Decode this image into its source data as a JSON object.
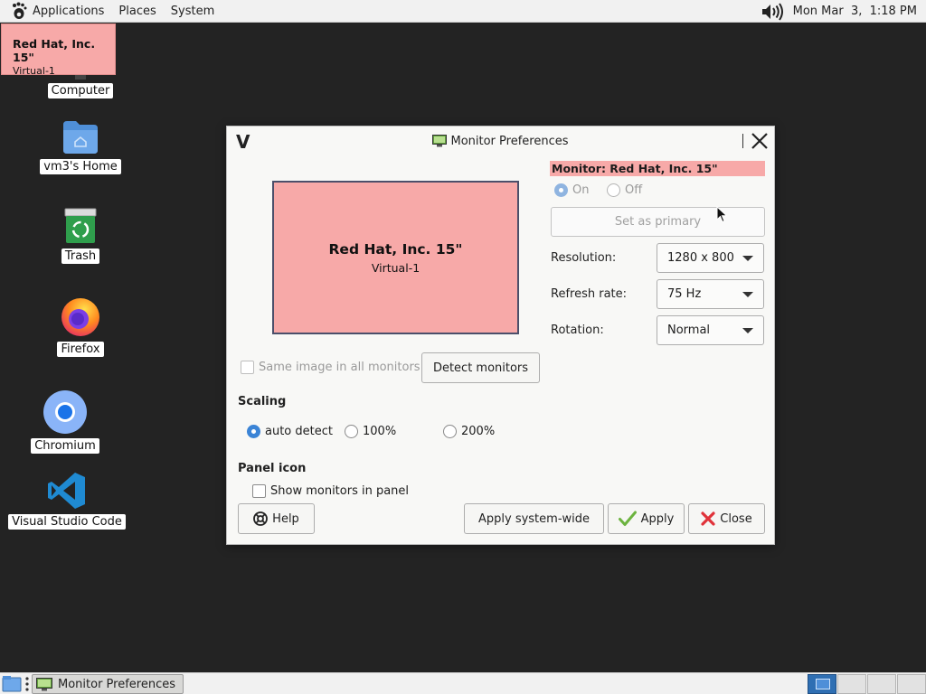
{
  "top_panel": {
    "menus": [
      "Applications",
      "Places",
      "System"
    ],
    "clock": "Mon Mar  3,  1:18 PM"
  },
  "desktop": {
    "icons": [
      {
        "label": "Computer",
        "icon": "computer-icon"
      },
      {
        "label": "vm3's Home",
        "icon": "home-folder-icon"
      },
      {
        "label": "Trash",
        "icon": "trash-icon"
      },
      {
        "label": "Firefox",
        "icon": "firefox-icon"
      },
      {
        "label": "Chromium",
        "icon": "chromium-icon"
      },
      {
        "label": "Visual Studio Code",
        "icon": "vscode-icon"
      }
    ]
  },
  "monitor_popup": {
    "name": "Red Hat, Inc. 15\"",
    "connector": "Virtual-1"
  },
  "dialog": {
    "title": "Monitor Preferences",
    "preview": {
      "name": "Red Hat, Inc. 15\"",
      "connector": "Virtual-1"
    },
    "monitor_header": "Monitor: Red Hat, Inc. 15\"",
    "power": {
      "on_label": "On",
      "off_label": "Off",
      "selected": "On"
    },
    "set_primary_label": "Set as primary",
    "resolution": {
      "label": "Resolution:",
      "value": "1280 x 800"
    },
    "refresh_rate": {
      "label": "Refresh rate:",
      "value": "75 Hz"
    },
    "rotation": {
      "label": "Rotation:",
      "value": "Normal"
    },
    "same_image_label": "Same image in all monitors",
    "detect_label": "Detect monitors",
    "scaling": {
      "title": "Scaling",
      "options": [
        "auto detect",
        "100%",
        "200%"
      ],
      "selected": "auto detect"
    },
    "panel_icon": {
      "title": "Panel icon",
      "show_label": "Show monitors in panel"
    },
    "buttons": {
      "help": "Help",
      "apply_system_wide": "Apply system-wide",
      "apply": "Apply",
      "close": "Close"
    }
  },
  "bottom_panel": {
    "task_label": "Monitor Preferences"
  },
  "colors": {
    "monitor_pink": "#f7a9a8",
    "accent_blue": "#3b84d6",
    "desktop_bg": "#232323"
  }
}
